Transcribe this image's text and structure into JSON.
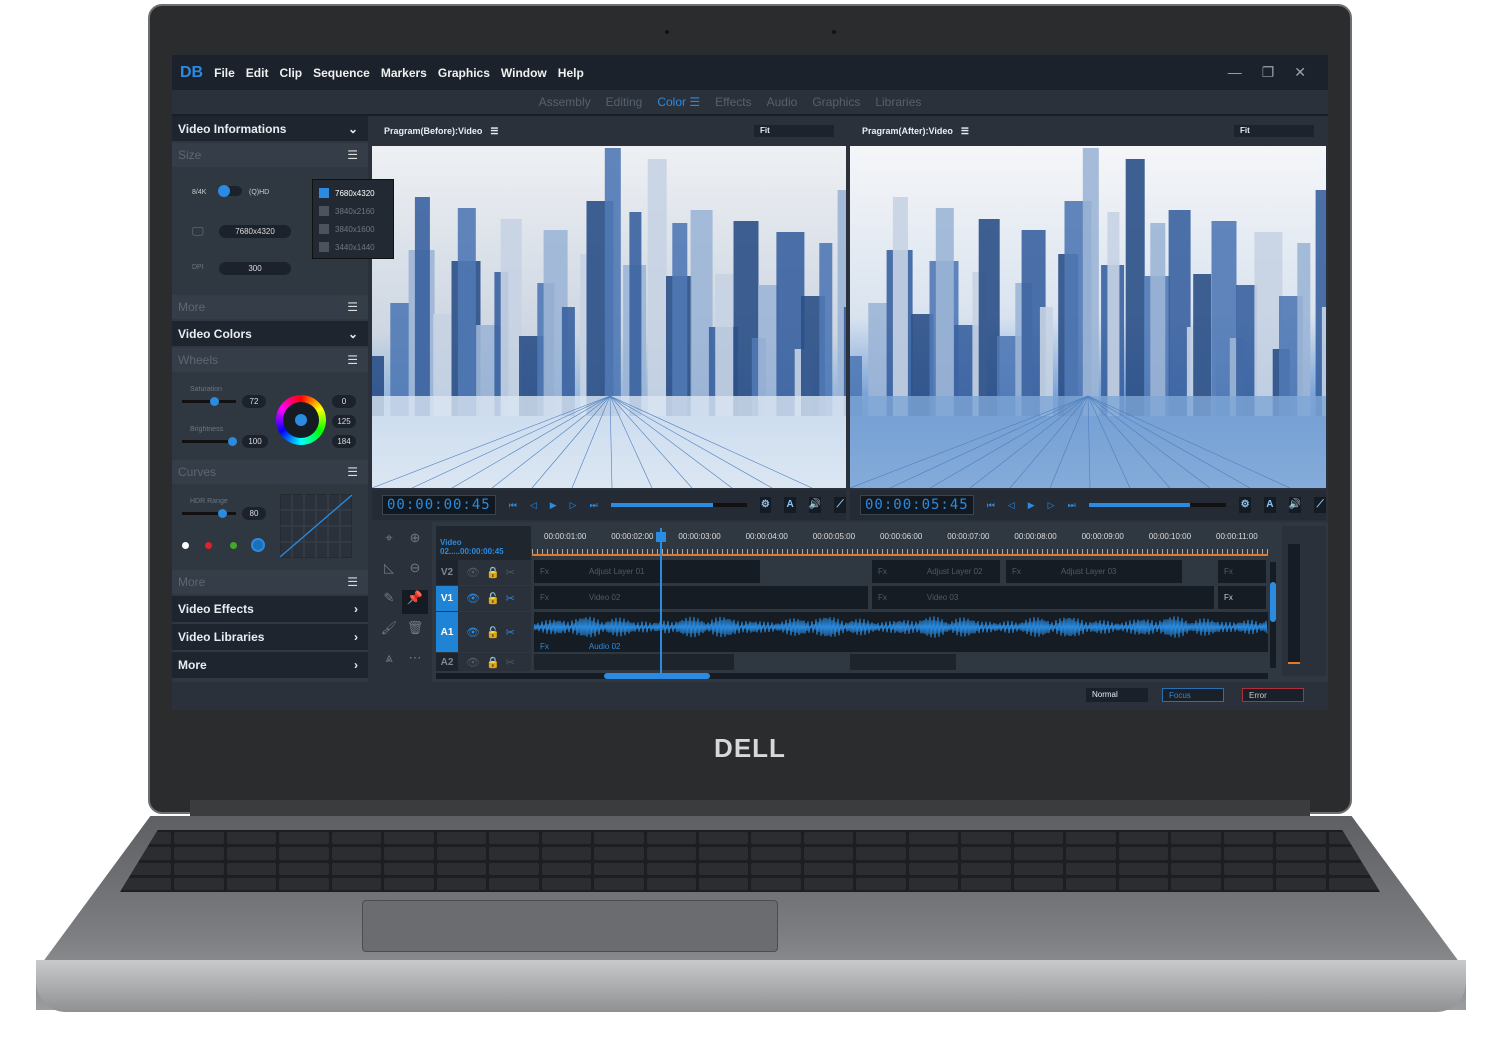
{
  "brand": {
    "logo": "DELL"
  },
  "app": {
    "logo": "DB",
    "menu": [
      "File",
      "Edit",
      "Clip",
      "Sequence",
      "Markers",
      "Graphics",
      "Window",
      "Help"
    ],
    "window_controls": {
      "minimize": "—",
      "restore": "❐",
      "close": "✕"
    },
    "workspaces": [
      "Assembly",
      "Editing",
      "Color",
      "Effects",
      "Audio",
      "Graphics",
      "Libraries"
    ],
    "active_workspace": "Color",
    "accent": "#2a8be0"
  },
  "left_panel": {
    "video_info": "Video Informations",
    "size": "Size",
    "toggle_left": "8/4K",
    "toggle_right": "(Q)HD",
    "resolution": "7680x4320",
    "dpi_label": "DPI",
    "dpi": "300",
    "res_options": [
      "7680x4320",
      "3840x2160",
      "3840x1600",
      "3440x1440"
    ],
    "selected_res": "7680x4320",
    "more1": "More",
    "video_colors": "Video Colors",
    "wheels": "Wheels",
    "saturation_label": "Saturation",
    "saturation": "72",
    "brightness_label": "Brightness",
    "brightness": "100",
    "wheel_values": [
      "0",
      "125",
      "184"
    ],
    "curves": "Curves",
    "hdr_label": "HDR Range",
    "hdr": "80",
    "more2": "More",
    "video_effects": "Video Effects",
    "video_libraries": "Video Libraries",
    "more3": "More"
  },
  "viewers": [
    {
      "title": "Pragram(Before):Video",
      "fit": "Fit",
      "timecode": "00:00:00:45",
      "progress": 0.75
    },
    {
      "title": "Pragram(After):Video",
      "fit": "Fit",
      "timecode": "00:00:05:45",
      "progress": 0.74
    }
  ],
  "timeline": {
    "sequence": "Video 02.....00:00:00:45",
    "ruler": [
      "00:00:01:00",
      "00:00:02:00",
      "00:00:03:00",
      "00:00:04:00",
      "00:00:05:00",
      "00:00:06:00",
      "00:00:07:00",
      "00:00:08:00",
      "00:00:09:00",
      "00:00:10:00",
      "00:00:11:00"
    ],
    "tracks": [
      "V2",
      "V1",
      "A1",
      "A2"
    ],
    "clips": {
      "fx": "Fx",
      "adjust1": "Adjust Layer 01",
      "adjust2": "Adjust Layer 02",
      "adjust3": "Adjust Layer 03",
      "video02": "Video 02",
      "video03": "Video 03",
      "audio02": "Audio 02"
    }
  },
  "status": {
    "normal": "Normal",
    "focus": "Focus",
    "error": "Error"
  }
}
